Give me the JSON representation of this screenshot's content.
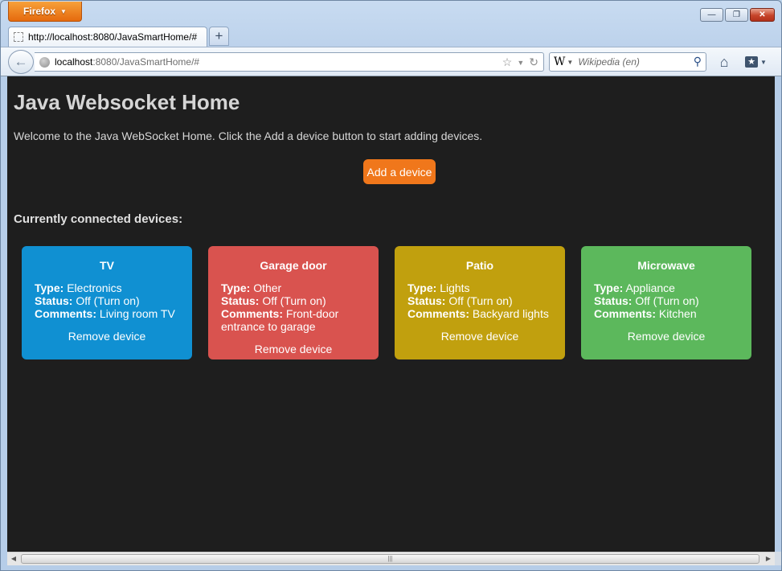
{
  "browser": {
    "menu_button_label": "Firefox",
    "tab_title": "http://localhost:8080/JavaSmartHome/#",
    "new_tab_label": "+",
    "url_host": "localhost",
    "url_rest": ":8080/JavaSmartHome/#",
    "search_engine_icon": "W",
    "search_placeholder": "Wikipedia (en)",
    "window_controls": {
      "minimize": "—",
      "maximize": "❐",
      "close": "✕"
    }
  },
  "page": {
    "title": "Java Websocket Home",
    "welcome": "Welcome to the Java WebSocket Home. Click the Add a device button to start adding devices.",
    "add_button": "Add a device",
    "devices_heading": "Currently connected devices:"
  },
  "labels": {
    "type": "Type:",
    "status": "Status:",
    "comments": "Comments:"
  },
  "devices": [
    {
      "name": "TV",
      "type": "Electronics",
      "status": "Off (Turn on)",
      "comments": "Living room TV",
      "remove": "Remove device",
      "color": "#1090d2"
    },
    {
      "name": "Garage door",
      "type": "Other",
      "status": "Off (Turn on)",
      "comments": "Front-door entrance to garage",
      "remove": "Remove device",
      "color": "#d9534f"
    },
    {
      "name": "Patio",
      "type": "Lights",
      "status": "Off (Turn on)",
      "comments": "Backyard lights",
      "remove": "Remove device",
      "color": "#c1a00e"
    },
    {
      "name": "Microwave",
      "type": "Appliance",
      "status": "Off (Turn on)",
      "comments": "Kitchen",
      "remove": "Remove device",
      "color": "#5cb85c"
    }
  ],
  "colors": {
    "background": "#1e1e1e",
    "add_button": "#f0771b"
  }
}
